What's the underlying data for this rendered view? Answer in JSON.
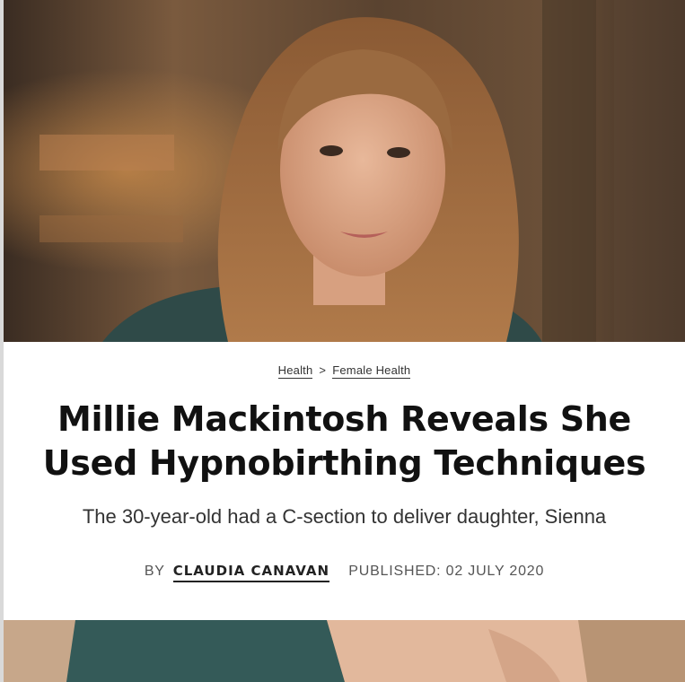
{
  "breadcrumb": {
    "items": [
      "Health",
      "Female Health"
    ],
    "separator": ">"
  },
  "headline": "Millie Mackintosh Reveals She Used Hypnobirthing Techniques",
  "standfirst": "The 30-year-old had a C-section to deliver daughter, Sienna",
  "byline": {
    "prefix": "BY",
    "author": "CLAUDIA CANAVAN",
    "published": "PUBLISHED: 02 JULY 2020"
  },
  "colors": {
    "headline": "#111111",
    "text": "#333333",
    "background": "#ffffff"
  },
  "images": {
    "hero": "portrait-photo",
    "secondary": "portrait-photo-crop"
  }
}
